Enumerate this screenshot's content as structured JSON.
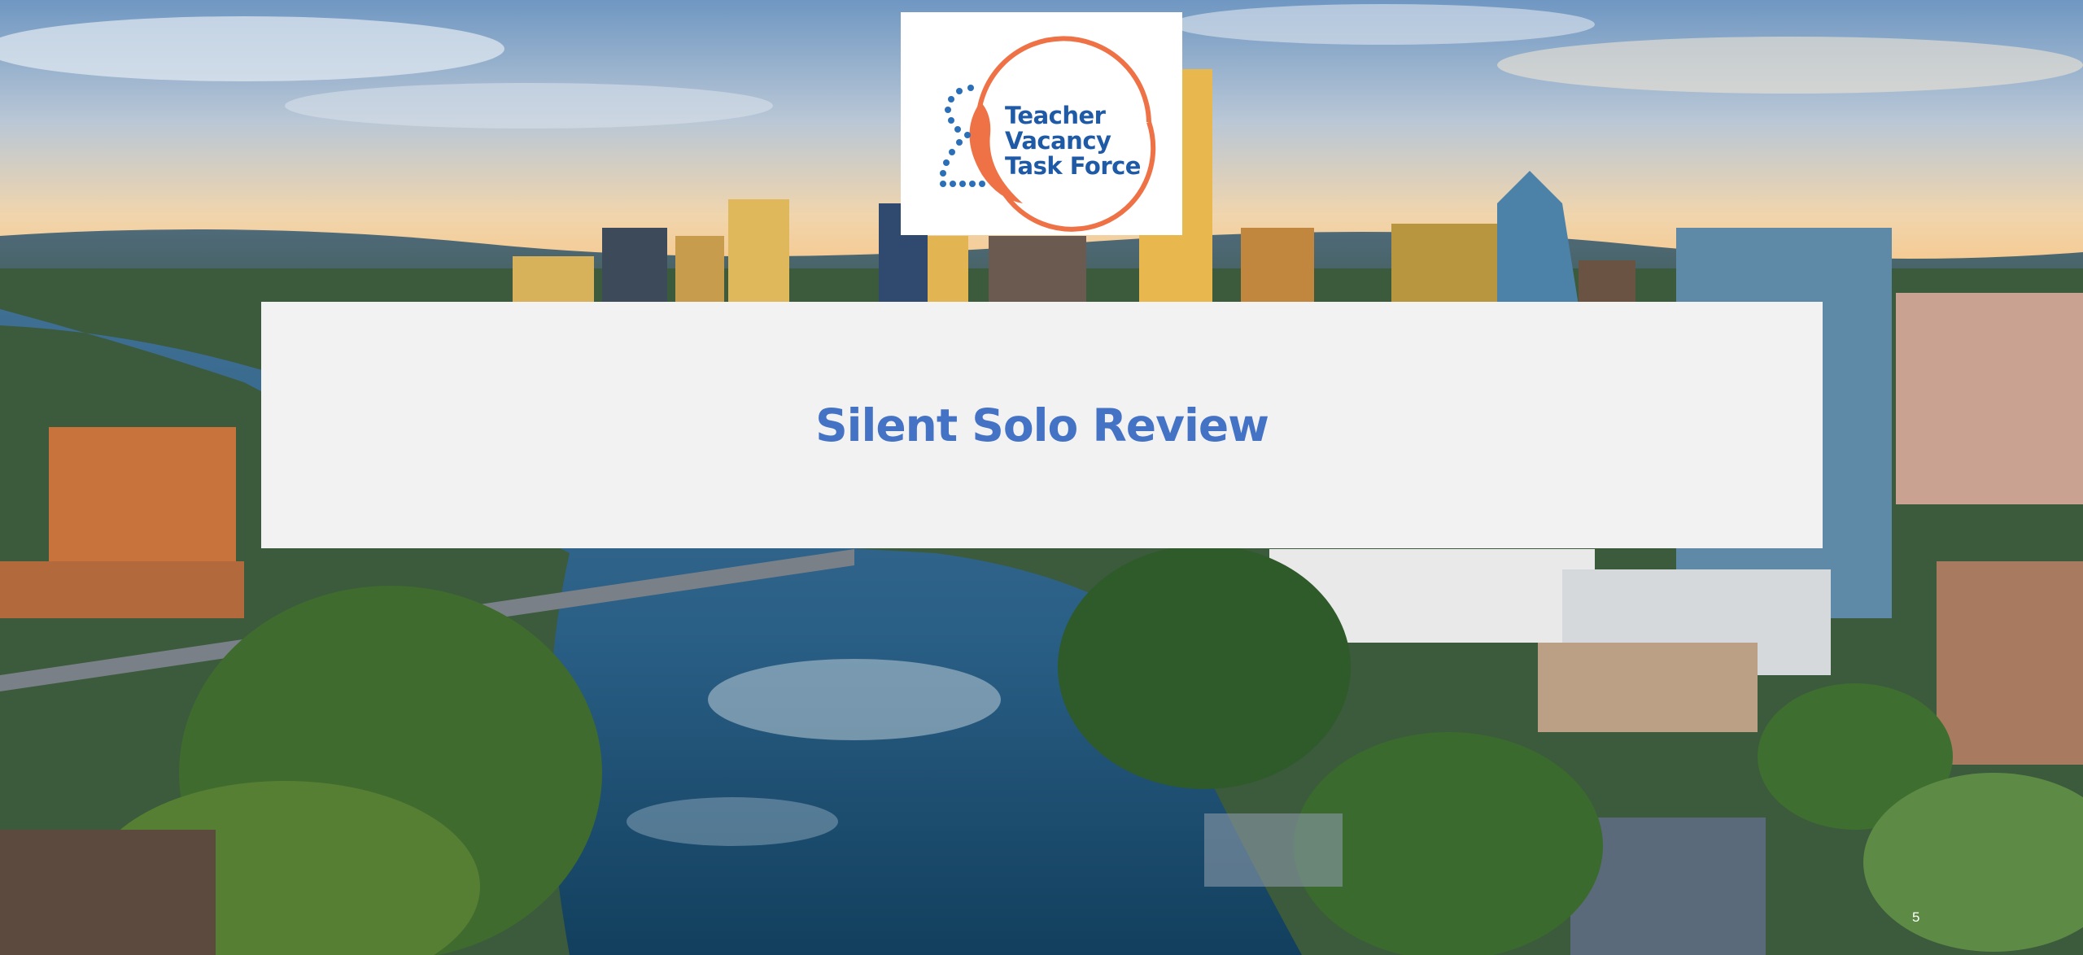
{
  "slide": {
    "title": "Silent Solo Review",
    "page_number": "5"
  },
  "logo": {
    "lines": [
      "Teacher",
      "Vacancy",
      "Task Force"
    ],
    "colors": {
      "text": "#1f5aa6",
      "arc": "#ee7245",
      "dots": "#2a6fb8"
    }
  },
  "background": {
    "description_icon": "city-skyline-photo"
  },
  "colors": {
    "title": "#4472c4",
    "panel": "#f2f2f2"
  }
}
